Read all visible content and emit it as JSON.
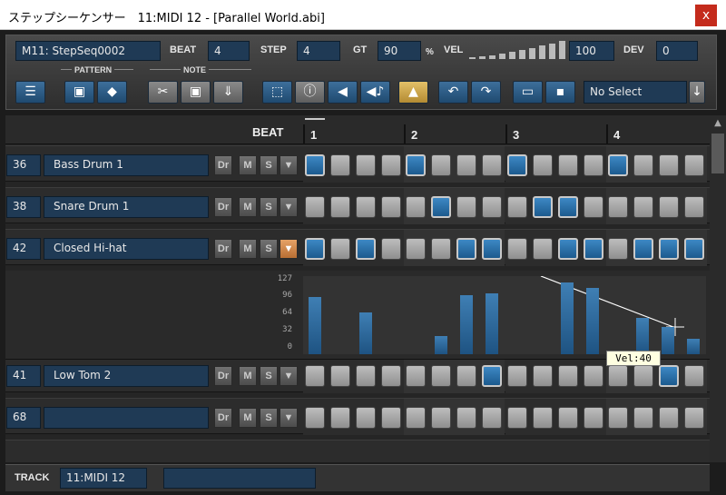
{
  "window": {
    "title": "ステップシーケンサー　11:MIDI 12 - [Parallel World.abi]",
    "close_label": "x"
  },
  "toolbar": {
    "sequence_name": "M11: StepSeq0002",
    "beat_label": "BEAT",
    "beat_value": "4",
    "step_label": "STEP",
    "step_value": "4",
    "gt_label": "GT",
    "gt_value": "90",
    "gt_unit": "%",
    "vel_label": "VEL",
    "vel_value": "100",
    "dev_label": "DEV",
    "dev_value": "0",
    "pattern_group": "PATTERN",
    "note_group": "NOTE",
    "select_value": "No Select",
    "icons": [
      "list-icon",
      "camera-icon",
      "eraser-icon",
      "scissors-icon",
      "copy-icon",
      "paste-icon",
      "select-icon",
      "info-icon",
      "speaker-icon",
      "speaker-note-icon",
      "up-arrow-icon",
      "undo-icon",
      "redo-icon",
      "folder-icon",
      "save-icon",
      "dropdown-arrow-icon"
    ]
  },
  "grid": {
    "header_label": "BEAT",
    "beat_numbers": [
      "1",
      "2",
      "3",
      "4"
    ],
    "rows": [
      {
        "note": "36",
        "name": "Bass Drum 1",
        "dr": "Dr",
        "m": "M",
        "s": "S",
        "steps": [
          1,
          0,
          0,
          0,
          1,
          0,
          0,
          0,
          1,
          0,
          0,
          0,
          1,
          0,
          0,
          0
        ],
        "expanded": false
      },
      {
        "note": "38",
        "name": "Snare Drum 1",
        "dr": "Dr",
        "m": "M",
        "s": "S",
        "steps": [
          0,
          0,
          0,
          0,
          0,
          1,
          0,
          0,
          0,
          1,
          1,
          0,
          0,
          0,
          0,
          0
        ],
        "expanded": false
      },
      {
        "note": "42",
        "name": "Closed Hi-hat",
        "dr": "Dr",
        "m": "M",
        "s": "S",
        "steps": [
          1,
          0,
          1,
          0,
          0,
          0,
          1,
          1,
          0,
          0,
          1,
          1,
          0,
          1,
          1,
          1
        ],
        "expanded": true
      },
      {
        "note": "41",
        "name": "Low Tom 2",
        "dr": "Dr",
        "m": "M",
        "s": "S",
        "steps": [
          0,
          0,
          0,
          0,
          0,
          0,
          0,
          1,
          0,
          0,
          0,
          0,
          0,
          0,
          1,
          0
        ],
        "expanded": false
      },
      {
        "note": "68",
        "name": "",
        "dr": "Dr",
        "m": "M",
        "s": "S",
        "steps": [
          0,
          0,
          0,
          0,
          0,
          0,
          0,
          0,
          0,
          0,
          0,
          0,
          0,
          0,
          0,
          0
        ],
        "expanded": false
      }
    ],
    "velocity_scale": [
      "127",
      "96",
      "64",
      "32",
      "0"
    ],
    "velocities": [
      95,
      0,
      70,
      0,
      0,
      0,
      0,
      0,
      0,
      0,
      0,
      0,
      0,
      0,
      0,
      0
    ],
    "hihat_velocities": [
      95,
      0,
      70,
      0,
      0,
      30,
      98,
      102,
      0,
      0,
      120,
      110,
      0,
      60,
      45,
      25
    ],
    "tooltip": "Vel:40"
  },
  "bottom": {
    "track_label": "TRACK",
    "track_value": "11:MIDI 12",
    "second_value": ""
  },
  "colors": {
    "accent_blue": "#2b6da5",
    "step_off": "#a8a8a8",
    "highlight_orange": "#d9894a",
    "gold": "#c9a24a"
  }
}
